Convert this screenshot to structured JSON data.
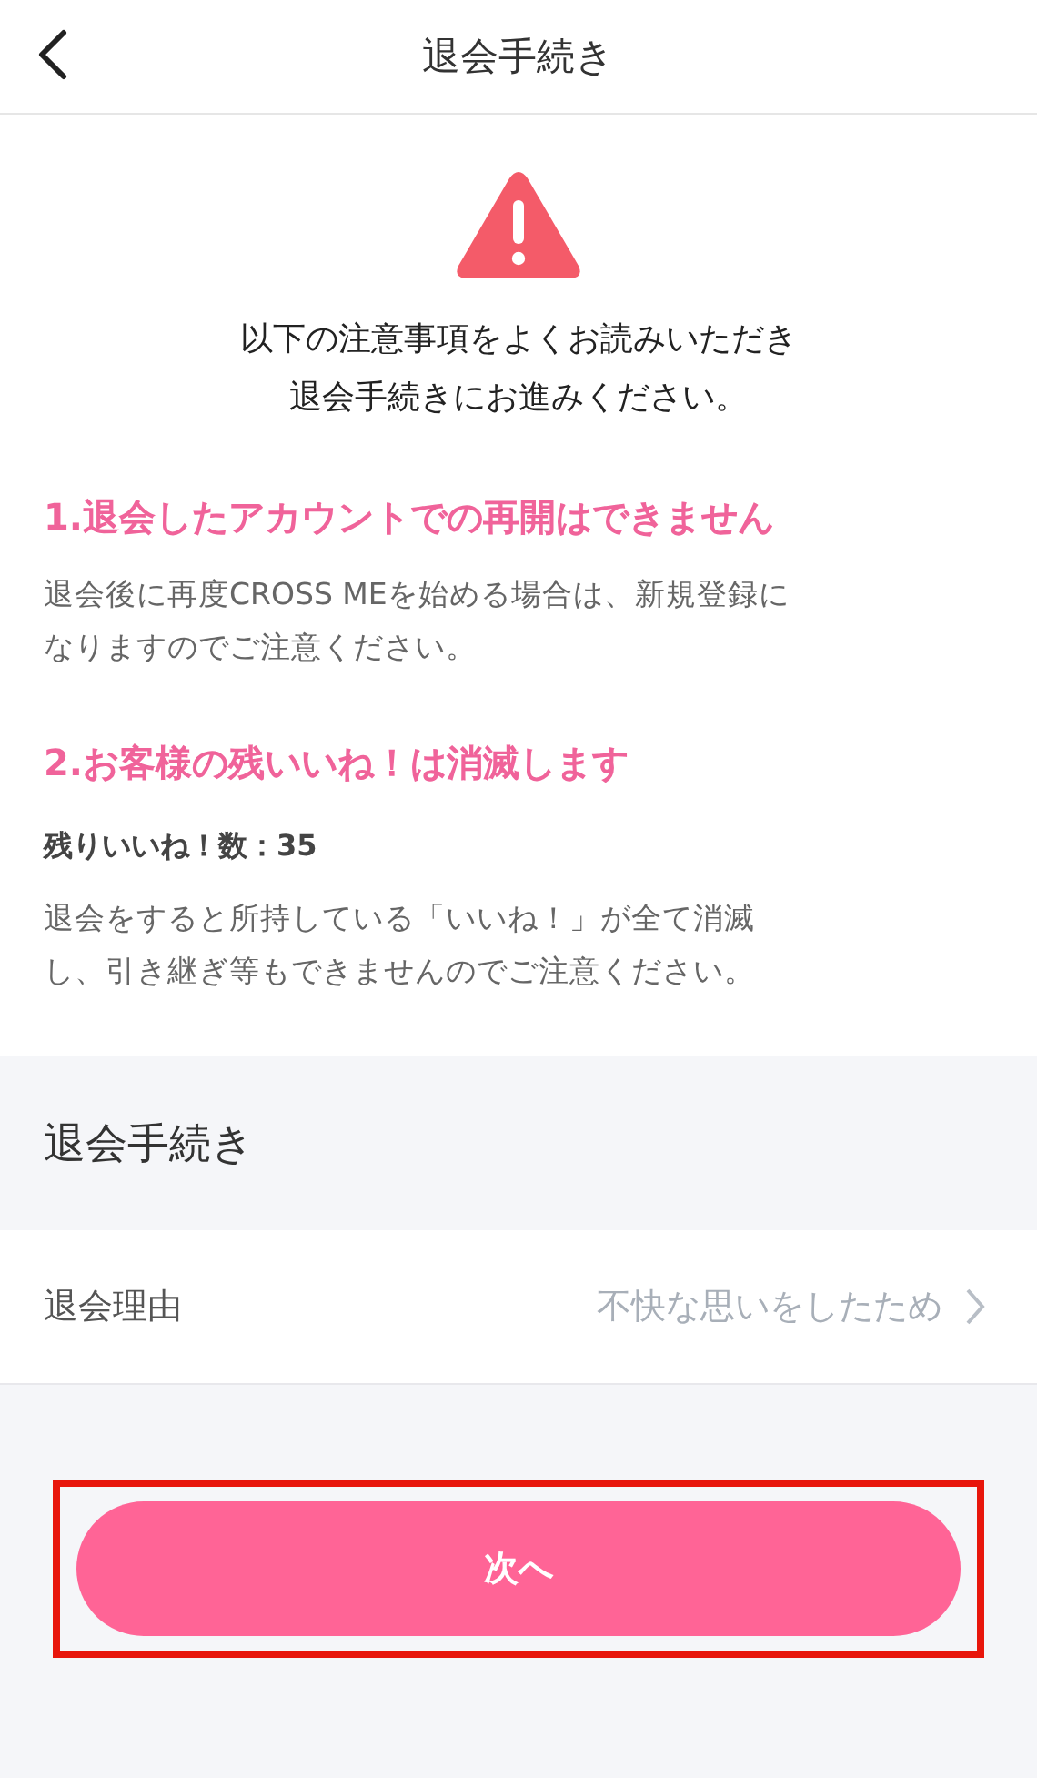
{
  "header": {
    "title": "退会手続き"
  },
  "intro": "以下の注意事項をよくお読みいただき退会手続きにお進みください。",
  "notices": [
    {
      "heading": "1.退会したアカウントでの再開はできません",
      "body": "退会後に再度CROSS MEを始める場合は、新規登録になりますのでご注意ください。"
    },
    {
      "heading": "2.お客様の残いいね！は消滅します",
      "count": "残りいいね！数：35",
      "body": "退会をすると所持している「いいね！」が全て消滅し、引き継ぎ等もできませんのでご注意ください。"
    }
  ],
  "procedure": {
    "title": "退会手続き",
    "rows": [
      {
        "label": "退会理由",
        "value": "不快な思いをしたため"
      }
    ]
  },
  "next_button": {
    "label": "次へ",
    "highlighted": true
  }
}
